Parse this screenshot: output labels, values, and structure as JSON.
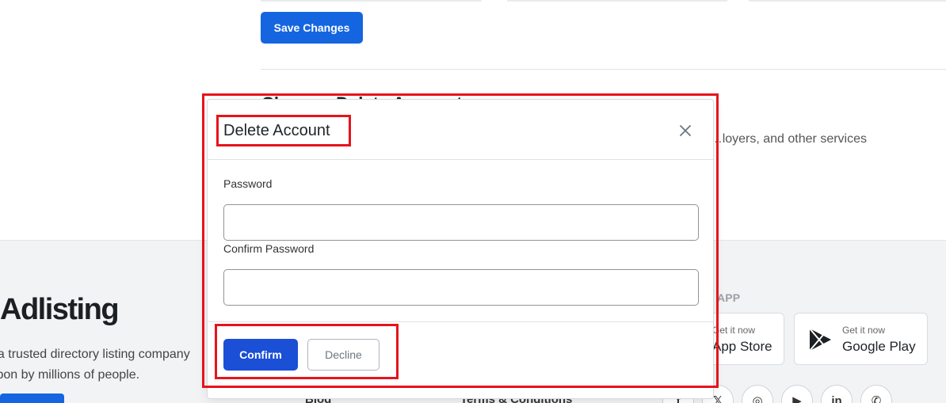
{
  "page": {
    "save_button": "Save Changes",
    "section_title": "Close or Delete Account",
    "section_desc": "…loyers, and other services"
  },
  "footer": {
    "brand": "Adlisting",
    "about_line1": "Adlisting is a trusted directory listing company",
    "about_line2": "relied upon by millions of people.",
    "links": [
      "Blog",
      "Terms & Conditions"
    ],
    "download_title": "DOWNLOAD OUR APP",
    "app_store": {
      "small": "Get it now",
      "big": "App Store"
    },
    "google_play": {
      "small": "Get it now",
      "big": "Google Play"
    },
    "social_icons": [
      "facebook-icon",
      "x-icon",
      "instagram-icon",
      "youtube-icon",
      "linkedin-icon",
      "whatsapp-icon"
    ]
  },
  "modal": {
    "title": "Delete Account",
    "password_label": "Password",
    "password_value": "",
    "confirm_label": "Confirm Password",
    "confirm_value": "",
    "confirm_button": "Confirm",
    "decline_button": "Decline"
  },
  "colors": {
    "primary": "#1565e0",
    "confirm": "#1a4fd6",
    "highlight": "#e8131b"
  }
}
